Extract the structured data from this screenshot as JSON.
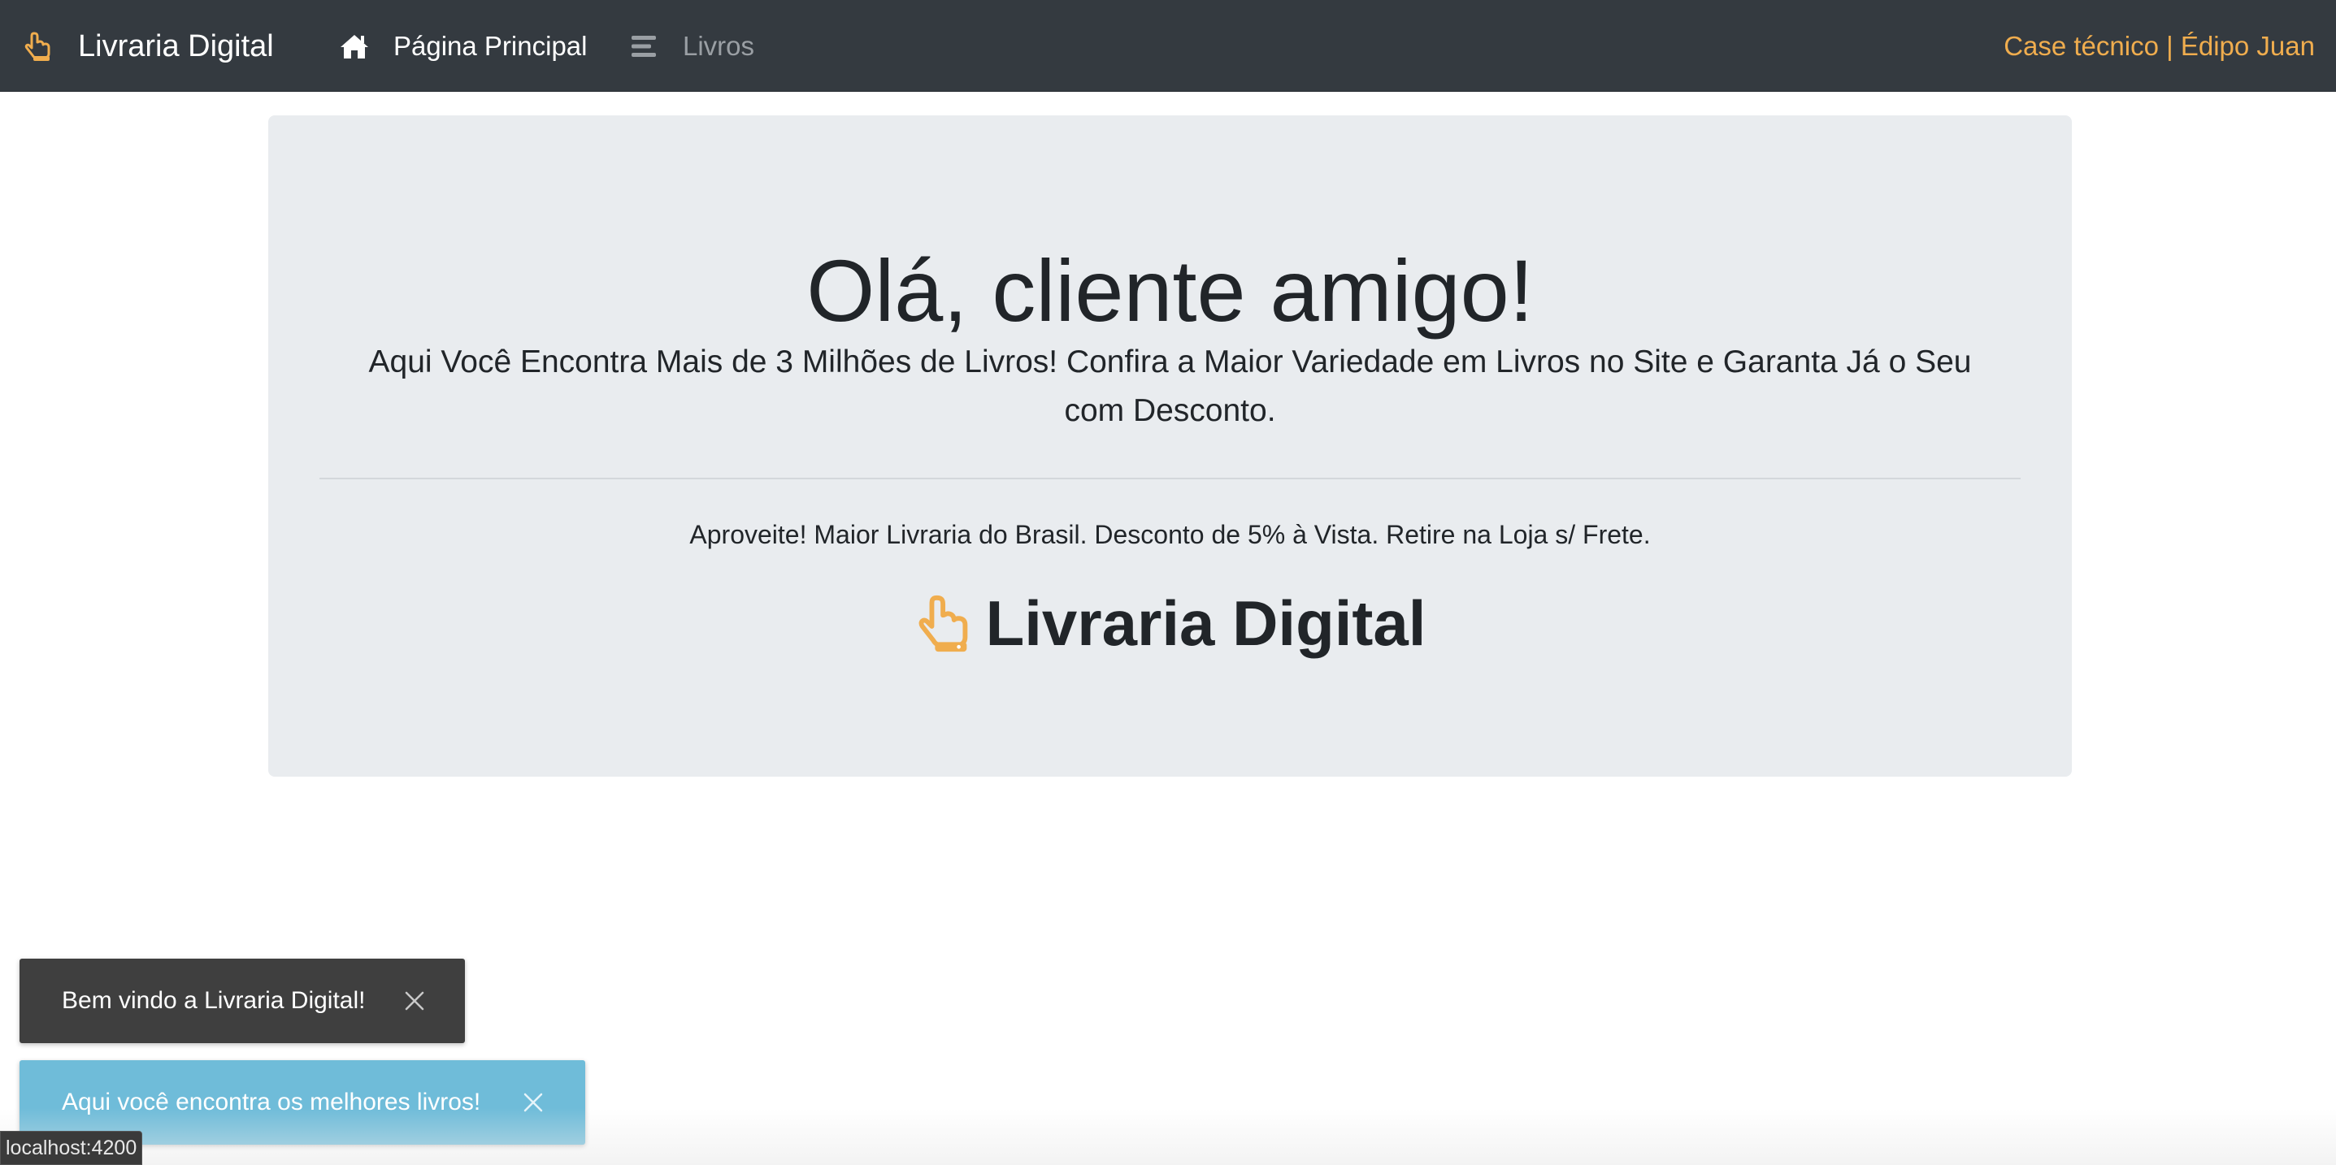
{
  "navbar": {
    "brand": "Livraria Digital",
    "brand_icon": "hand-pointer-icon",
    "home_label": "Página Principal",
    "home_icon": "home-icon",
    "books_label": "Livros",
    "books_icon": "list-icon",
    "author_link": "Case técnico | Édipo Juan"
  },
  "hero": {
    "title": "Olá, cliente amigo!",
    "lead": "Aqui Você Encontra Mais de 3 Milhões de Livros! Confira a Maior Variedade em Livros no Site e Garanta Já o Seu com Desconto.",
    "note": "Aproveite! Maior Livraria do Brasil. Desconto de 5% à Vista. Retire na Loja s/ Frete.",
    "brand": "Livraria Digital"
  },
  "toasts": [
    {
      "message": "Bem vindo a Livraria Digital!"
    },
    {
      "message": "Aqui você encontra os melhores livros!"
    }
  ],
  "status_bar": {
    "url": "localhost:4200"
  },
  "colors": {
    "navbar_bg": "#343a40",
    "accent": "#f0ad4e",
    "jumbotron_bg": "#e9ecef",
    "toast_dark": "#3f3f3f",
    "toast_info": "#6fbcd9"
  }
}
